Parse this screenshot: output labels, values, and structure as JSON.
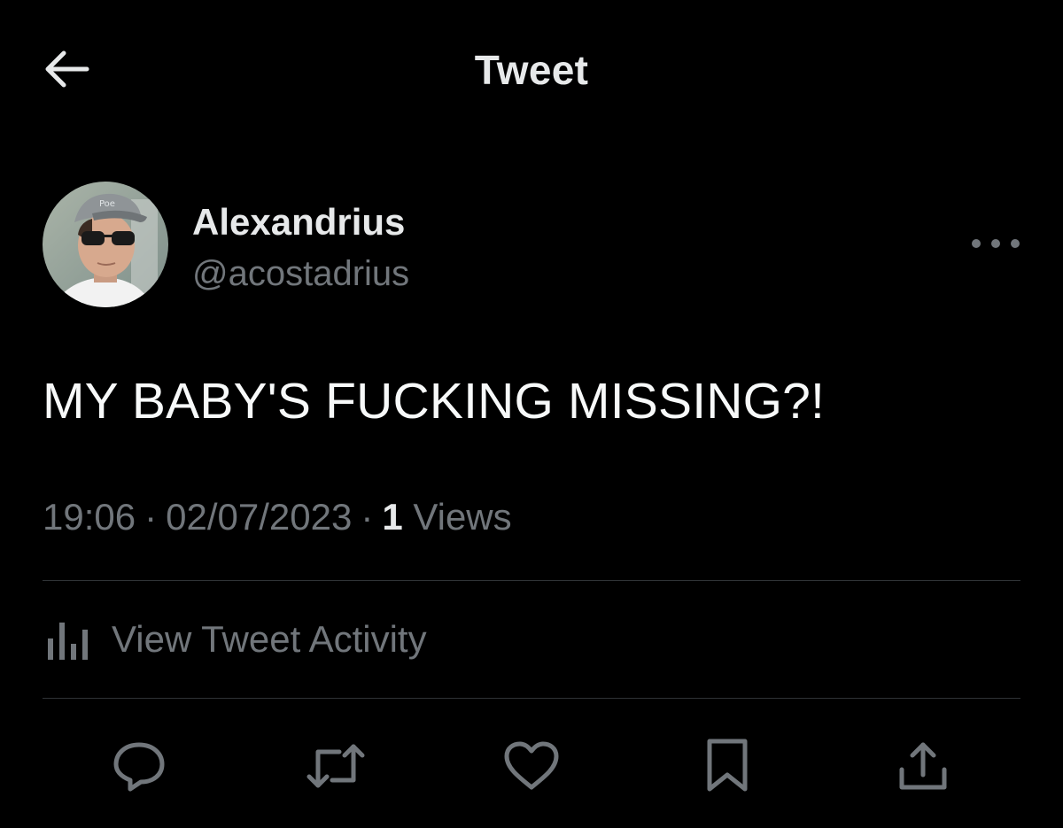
{
  "header": {
    "title": "Tweet",
    "back_icon": "arrow-left-icon"
  },
  "author": {
    "display_name": "Alexandrius",
    "handle": "@acostadrius",
    "more_icon": "ellipsis-icon"
  },
  "tweet": {
    "text": "MY BABY'S FUCKING MISSING?!",
    "time": "19:06",
    "date": "02/07/2023",
    "separator": "·",
    "views_count": "1",
    "views_label": "Views"
  },
  "activity": {
    "label": "View Tweet Activity",
    "icon": "bar-chart-icon"
  },
  "actions": {
    "reply_icon": "reply-icon",
    "retweet_icon": "retweet-icon",
    "like_icon": "heart-icon",
    "bookmark_icon": "bookmark-icon",
    "share_icon": "share-icon"
  },
  "colors": {
    "background": "#000000",
    "primary_text": "#e7e9ea",
    "secondary_text": "#71767b",
    "divider": "#2f3336"
  }
}
